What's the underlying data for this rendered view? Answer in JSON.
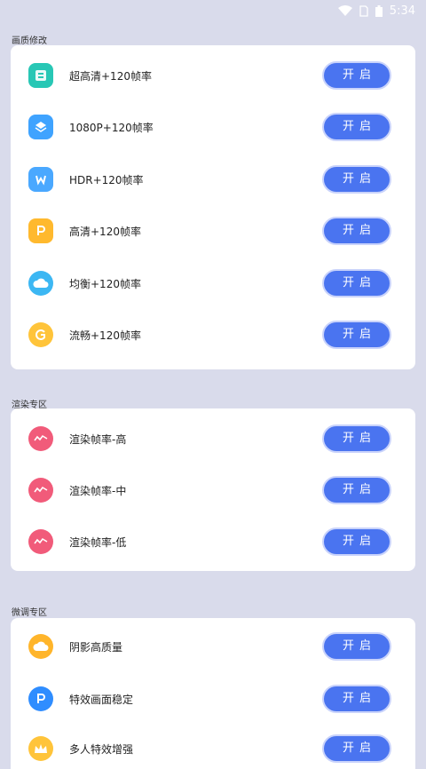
{
  "status_bar": {
    "time": "5:34"
  },
  "sections": [
    {
      "title": "画质修改",
      "items": [
        {
          "label": "超高清+120帧率",
          "icon": "grid-icon",
          "color": "#28c7b5",
          "button": "开启"
        },
        {
          "label": "1080P+120帧率",
          "icon": "layers-icon",
          "color": "#3fa3ff",
          "button": "开启"
        },
        {
          "label": "HDR+120帧率",
          "icon": "w-badge-icon",
          "color": "#4aa8ff",
          "button": "开启"
        },
        {
          "label": "高清+120帧率",
          "icon": "p-badge-icon",
          "color": "#ffb92e",
          "button": "开启"
        },
        {
          "label": "均衡+120帧率",
          "icon": "cloud-icon",
          "color": "#3cb7f3",
          "button": "开启"
        },
        {
          "label": "流畅+120帧率",
          "icon": "g-coin-icon",
          "color": "#ffc43a",
          "button": "开启"
        }
      ]
    },
    {
      "title": "渲染专区",
      "items": [
        {
          "label": "渲染帧率-高",
          "icon": "render-icon",
          "color": "#f15b7a",
          "button": "开启"
        },
        {
          "label": "渲染帧率-中",
          "icon": "render-icon",
          "color": "#f15b7a",
          "button": "开启"
        },
        {
          "label": "渲染帧率-低",
          "icon": "render-icon",
          "color": "#f15b7a",
          "button": "开启"
        }
      ]
    },
    {
      "title": "微调专区",
      "items": [
        {
          "label": "阴影高质量",
          "icon": "cloud-orange-icon",
          "color": "#ffb52b",
          "button": "开启"
        },
        {
          "label": "特效画面稳定",
          "icon": "p-blue-icon",
          "color": "#2f8dff",
          "button": "开启"
        },
        {
          "label": "多人特效增强",
          "icon": "crown-icon",
          "color": "#ffc43a",
          "button": "开启"
        }
      ]
    }
  ]
}
